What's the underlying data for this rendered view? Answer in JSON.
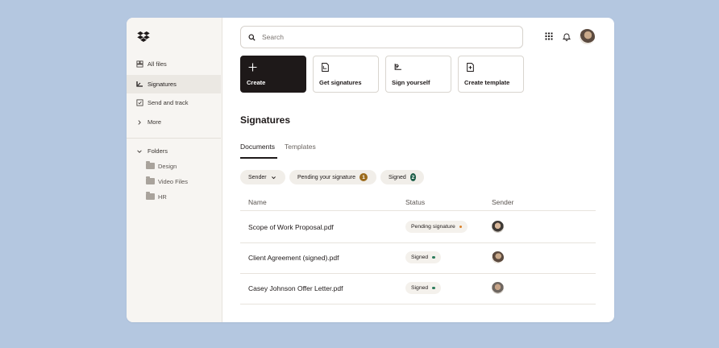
{
  "sidebar": {
    "items": [
      {
        "label": "All files",
        "icon": "all-files-icon"
      },
      {
        "label": "Signatures",
        "icon": "signature-icon",
        "active": true
      },
      {
        "label": "Send and track",
        "icon": "send-track-icon"
      },
      {
        "label": "More",
        "icon": "chevron-right-icon"
      }
    ],
    "folders_label": "Folders",
    "folders": [
      "Design",
      "Video Files",
      "HR"
    ]
  },
  "search": {
    "placeholder": "Search"
  },
  "actions": [
    {
      "label": "Create",
      "icon": "plus-icon"
    },
    {
      "label": "Get signatures",
      "icon": "get-signatures-icon"
    },
    {
      "label": "Sign yourself",
      "icon": "sign-yourself-icon"
    },
    {
      "label": "Create template",
      "icon": "template-icon"
    }
  ],
  "page": {
    "title": "Signatures"
  },
  "tabs": [
    {
      "label": "Documents",
      "active": true
    },
    {
      "label": "Templates",
      "active": false
    }
  ],
  "filters": {
    "sender": "Sender",
    "pending": {
      "label": "Pending your signature",
      "count": "1",
      "color": "#9b6a1c"
    },
    "signed": {
      "label": "Signed",
      "count": "2",
      "color": "#1d5e48"
    }
  },
  "table": {
    "headers": {
      "name": "Name",
      "status": "Status",
      "sender": "Sender"
    },
    "rows": [
      {
        "name": "Scope of Work Proposal.pdf",
        "status": "Pending signature",
        "dot_color": "#d9822b"
      },
      {
        "name": "Client Agreement (signed).pdf",
        "status": "Signed",
        "dot_color": "#2c7a5b"
      },
      {
        "name": "Casey Johnson Offer Letter.pdf",
        "status": "Signed",
        "dot_color": "#2c7a5b"
      }
    ]
  },
  "colors": {
    "background": "#b4c7e0",
    "accent_dark": "#1e1919"
  }
}
